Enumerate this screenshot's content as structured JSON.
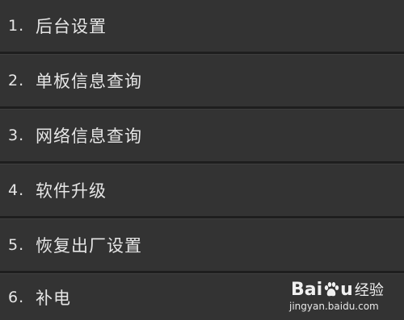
{
  "menu": {
    "items": [
      {
        "num": "1.",
        "label": "后台设置"
      },
      {
        "num": "2.",
        "label": "单板信息查询"
      },
      {
        "num": "3.",
        "label": "网络信息查询"
      },
      {
        "num": "4.",
        "label": "软件升级"
      },
      {
        "num": "5.",
        "label": "恢复出厂设置"
      },
      {
        "num": "6.",
        "label": "补电"
      }
    ]
  },
  "watermark": {
    "logo_left": "Bai",
    "logo_right": "u",
    "logo_cn": "经验",
    "url": "jingyan.baidu.com"
  }
}
